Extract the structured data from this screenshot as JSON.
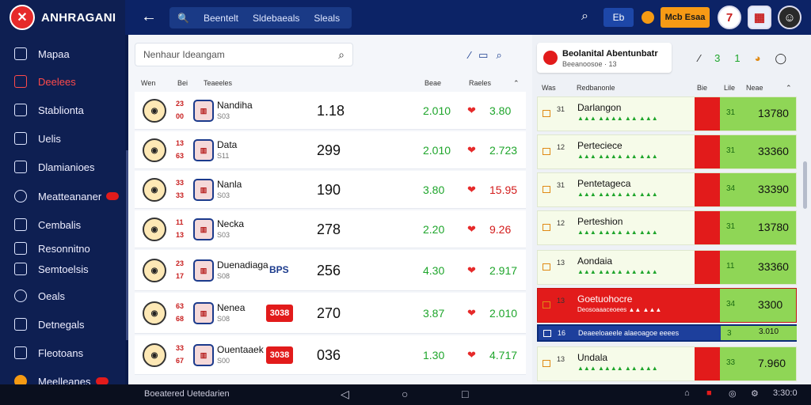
{
  "brand": {
    "logo_glyph": "✕",
    "name": "ANHRAGANI"
  },
  "sidebar": {
    "items": [
      {
        "label": "Mapaa"
      },
      {
        "label": "Deelees"
      },
      {
        "label": "Stablionta"
      },
      {
        "label": "Uelis"
      },
      {
        "label": "Dlamianioes"
      },
      {
        "label": "Meatteananer"
      },
      {
        "label": "Cembalis"
      },
      {
        "label": "Resonnitno"
      },
      {
        "label": "Semtoelsis"
      },
      {
        "label": "Oeals"
      },
      {
        "label": "Detnegals"
      },
      {
        "label": "Fleotoans"
      },
      {
        "label": "Meelleanes"
      }
    ]
  },
  "topbar": {
    "search_seg1": "Beentelt",
    "search_seg2": "Sldebaeals",
    "search_seg3": "Sleals",
    "lang": "Eb",
    "promo": "Mcb Esaa",
    "avatar1": "7"
  },
  "main": {
    "search_placeholder": "Nenhaur Ideangam",
    "col_headers": [
      "Wen",
      "Bei",
      "Teaeeles",
      "Beae",
      "Raeles"
    ],
    "rows": [
      {
        "odd1": "23",
        "odd2": "00",
        "name": "Nandiha",
        "sub": "S03",
        "big": "1.18",
        "g": "2.010",
        "r": "3.80",
        "r_red": false,
        "chip": "",
        "tag": ""
      },
      {
        "odd1": "13",
        "odd2": "63",
        "name": "Data",
        "sub": "S11",
        "big": "299",
        "g": "2.010",
        "r": "2.723",
        "r_red": false,
        "chip": "",
        "tag": ""
      },
      {
        "odd1": "33",
        "odd2": "33",
        "name": "Nanla",
        "sub": "S03",
        "big": "190",
        "g": "3.80",
        "r": "15.95",
        "r_red": true,
        "chip": "",
        "tag": ""
      },
      {
        "odd1": "11",
        "odd2": "13",
        "name": "Necka",
        "sub": "S03",
        "big": "278",
        "g": "2.20",
        "r": "9.26",
        "r_red": true,
        "chip": "",
        "tag": ""
      },
      {
        "odd1": "23",
        "odd2": "17",
        "name": "Duenadiaga",
        "sub": "S08",
        "big": "256",
        "g": "4.30",
        "r": "2.917",
        "r_red": false,
        "chip": "",
        "tag": "BPS"
      },
      {
        "odd1": "63",
        "odd2": "68",
        "name": "Nenea",
        "sub": "S08",
        "big": "270",
        "g": "3.87",
        "r": "2.010",
        "r_red": false,
        "chip": "3038",
        "tag": ""
      },
      {
        "odd1": "33",
        "odd2": "67",
        "name": "Ouentaaek",
        "sub": "S00",
        "big": "036",
        "g": "1.30",
        "r": "4.717",
        "r_red": false,
        "chip": "3038",
        "tag": ""
      }
    ]
  },
  "right": {
    "card_title": "Beolanital Abentunbatr",
    "card_sub": "Beeanoosoe · 13",
    "icon_glyph": "31",
    "col_headers": [
      "Was",
      "Redbanonle",
      "Bie",
      "Lile",
      "Neae"
    ],
    "rows": [
      {
        "num": "31",
        "name": "Darlangon",
        "sub": "▲▲▲ ▲▲▲▲ ▲▲ ▲▲▲",
        "g": "31",
        "score": "13780",
        "style": "normal"
      },
      {
        "num": "12",
        "name": "Perteciece",
        "sub": "▲▲▲ ▲▲▲▲ ▲▲ ▲▲▲",
        "g": "31",
        "score": "33360",
        "style": "normal"
      },
      {
        "num": "31",
        "name": "Pentetageca",
        "sub": "▲▲▲ ▲▲▲▲ ▲▲ ▲▲▲",
        "g": "34",
        "score": "33390",
        "style": "normal"
      },
      {
        "num": "12",
        "name": "Perteshion",
        "sub": "▲▲▲ ▲▲▲▲ ▲▲ ▲▲▲",
        "g": "31",
        "score": "13780",
        "style": "normal"
      },
      {
        "num": "13",
        "name": "Aondaia",
        "sub": "▲▲▲ ▲▲▲▲ ▲▲ ▲▲▲",
        "g": "11",
        "score": "33360",
        "style": "normal"
      },
      {
        "num": "13",
        "name": "Goetuohocre",
        "sub": "Deosoaaaceoees ▲▲ ▲▲▲",
        "g": "34",
        "score": "3300",
        "style": "hl"
      },
      {
        "num": "16",
        "name": "",
        "sub": "Deaeeloaeele alaeoagoe eeees",
        "g": "3",
        "score": "3.010",
        "style": "bluebar"
      },
      {
        "num": "13",
        "name": "Undala",
        "sub": "▲▲▲ ▲▲▲▲ ▲▲ ▲▲▲",
        "g": "33",
        "score": "7.960",
        "style": "normal"
      }
    ]
  },
  "bottombar": {
    "label": "Boeatered Uetedarien",
    "time": "3:30:0"
  }
}
